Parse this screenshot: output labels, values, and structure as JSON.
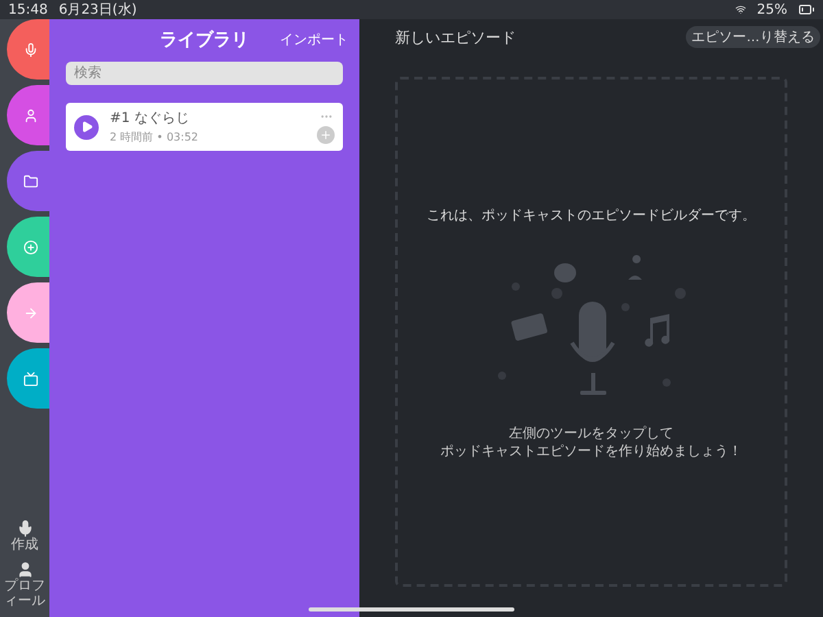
{
  "status_bar": {
    "time": "15:48",
    "date": "6月23日(水)",
    "battery": "25%"
  },
  "rail": {
    "items": [
      {
        "color": "#f45f5c"
      },
      {
        "color": "#d54fe3"
      },
      {
        "color": "#8b55e6"
      },
      {
        "color": "#2fcf9b"
      },
      {
        "color": "#ffb0df"
      },
      {
        "color": "#00aec6"
      }
    ],
    "bottom": [
      {
        "label": "作成"
      },
      {
        "label": "プロフィール"
      }
    ]
  },
  "library": {
    "title": "ライブラリ",
    "import": "インポート",
    "search": {
      "placeholder": "検索"
    },
    "episodes": [
      {
        "title": "#1 なぐらじ",
        "meta": "2 時間前 • 03:52"
      }
    ]
  },
  "main": {
    "title": "新しいエピソード",
    "switch_button": "エピソー…り替える",
    "message": "これは、ポッドキャストのエピソードビルダーです。",
    "hint_lines": [
      "左側のツールをタップして",
      "ポッドキャストエピソードを作り始めましょう！"
    ]
  }
}
